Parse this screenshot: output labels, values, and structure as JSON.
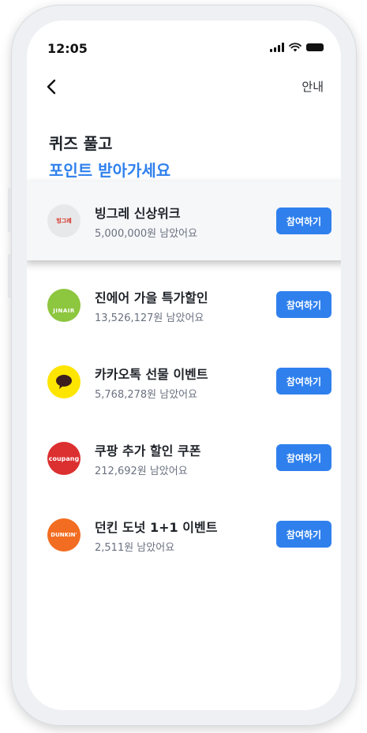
{
  "status_bar": {
    "time": "12:05"
  },
  "header": {
    "guide_label": "안내"
  },
  "hero": {
    "line1": "퀴즈 풀고",
    "line2": "포인트 받아가세요"
  },
  "quizzes": [
    {
      "name": "빙그레 신상위크",
      "remaining": "5,000,000원 남았어요",
      "button": "참여하기",
      "logo_text": "빙그레"
    },
    {
      "name": "진에어 가을 특가할인",
      "remaining": "13,526,127원 남았어요",
      "button": "참여하기",
      "logo_text": "JINAIR"
    },
    {
      "name": "카카오톡 선물 이벤트",
      "remaining": "5,768,278원 남았어요",
      "button": "참여하기",
      "logo_text": ""
    },
    {
      "name": "쿠팡 추가 할인 쿠폰",
      "remaining": "212,692원 남았어요",
      "button": "참여하기",
      "logo_text": "coupang"
    },
    {
      "name": "던킨 도넛 1+1 이벤트",
      "remaining": "2,511원 남았어요",
      "button": "참여하기",
      "logo_text": "DUNKIN'"
    }
  ],
  "colors": {
    "accent": "#2f80ed",
    "kakao": "#fee500",
    "coupang": "#dc2f2f",
    "dunkin": "#f26d21",
    "jinair": "#8dc63f"
  }
}
